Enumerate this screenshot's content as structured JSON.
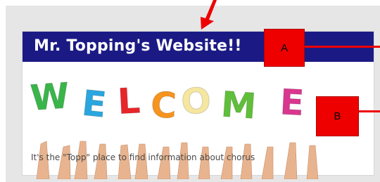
{
  "site": {
    "title": "Mr. Topping's Website!!",
    "tagline": "It's the \"Topp\" place to find information about chorus"
  },
  "welcome_banner": {
    "letters": [
      {
        "char": "W",
        "color": "#3ab54a"
      },
      {
        "char": "E",
        "color": "#2aa6de"
      },
      {
        "char": "L",
        "color": "#e8262a"
      },
      {
        "char": "C",
        "color": "#f7941d"
      },
      {
        "char": "O",
        "color": "#f5e6a0"
      },
      {
        "char": "M",
        "color": "#5fbf3a"
      },
      {
        "char": "E",
        "color": "#d9368f"
      }
    ]
  },
  "annotations": {
    "callout_a": "A",
    "callout_b": "B",
    "color": "#ee0000"
  },
  "colors": {
    "title_bar": "#1b1a85",
    "panel": "#e6e6e6"
  }
}
